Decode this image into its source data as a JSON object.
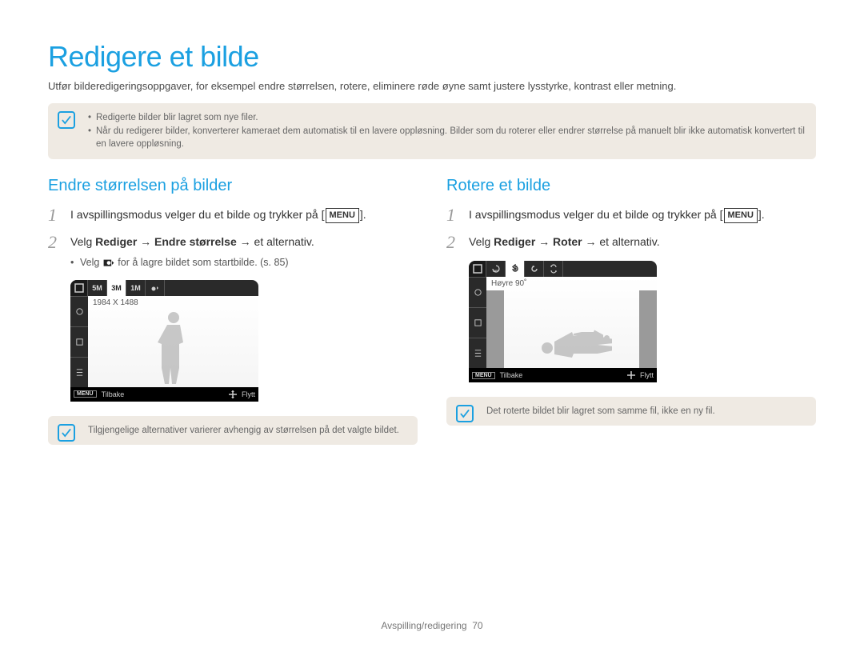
{
  "page": {
    "title": "Redigere et bilde",
    "intro": "Utfør bilderedigeringsoppgaver, for eksempel endre størrelsen, rotere, eliminere røde øyne samt justere lysstyrke, kontrast eller metning.",
    "footer_section": "Avspilling/redigering",
    "footer_page": "70"
  },
  "top_note": {
    "items": [
      "Redigerte bilder blir lagret som nye filer.",
      "Når du redigerer bilder, konverterer kameraet dem automatisk til en lavere oppløsning. Bilder som du roterer eller endrer størrelse på manuelt blir ikke automatisk konvertert til en lavere oppløsning."
    ]
  },
  "left": {
    "heading": "Endre størrelsen på bilder",
    "step1_prefix": "I avspillingsmodus velger du et bilde og trykker på ",
    "step1_menu": "MENU",
    "step1_suffix": ".",
    "step2_prefix": "Velg ",
    "step2_bold1": "Rediger",
    "step2_mid1": " → ",
    "step2_bold2": "Endre størrelse",
    "step2_mid2": " → et alternativ.",
    "sub_bullet_prefix": "Velg ",
    "sub_bullet_suffix": " for å lagre bildet som startbilde. (s. 85)",
    "screenshot": {
      "toolbar": [
        "◻",
        "5M",
        "3M",
        "1M",
        "◉"
      ],
      "label": "1984 X 1488",
      "footer_back": "Tilbake",
      "footer_menu": "MENU",
      "footer_move": "Flytt"
    },
    "bottom_note": "Tilgjengelige alternativer varierer avhengig av størrelsen på det valgte bildet."
  },
  "right": {
    "heading": "Rotere et bilde",
    "step1_prefix": "I avspillingsmodus velger du et bilde og trykker på ",
    "step1_menu": "MENU",
    "step1_suffix": ".",
    "step2_prefix": "Velg ",
    "step2_bold1": "Rediger",
    "step2_mid1": " → ",
    "step2_bold2": "Roter",
    "step2_mid2": " → et alternativ.",
    "screenshot": {
      "label": "Høyre 90˚",
      "footer_back": "Tilbake",
      "footer_menu": "MENU",
      "footer_move": "Flytt"
    },
    "bottom_note": "Det roterte bildet blir lagret som samme fil, ikke en ny fil."
  }
}
